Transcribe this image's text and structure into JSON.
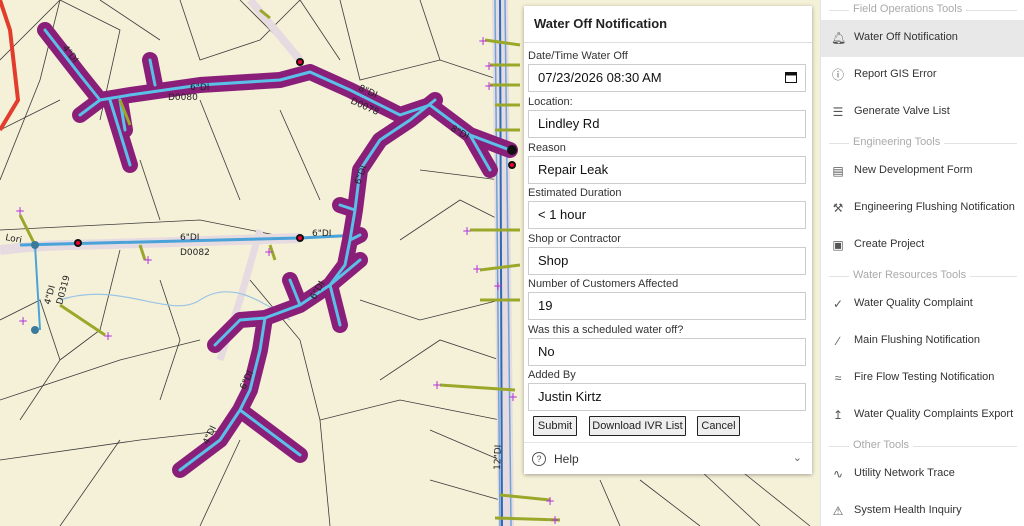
{
  "map": {
    "pipe_labels": [
      {
        "text": "4\"DI",
        "k": "a"
      },
      {
        "text": "6\"DI",
        "k": "b"
      },
      {
        "text": "D0080",
        "k": "c"
      },
      {
        "text": "8\"DI",
        "k": "d"
      },
      {
        "text": "D0078",
        "k": "e"
      },
      {
        "text": "8\"DI",
        "k": "f"
      },
      {
        "text": "6\"DI",
        "k": "g"
      },
      {
        "text": "6\"DI",
        "k": "h"
      },
      {
        "text": "6\"DI",
        "k": "i"
      },
      {
        "text": "D0082",
        "k": "j"
      },
      {
        "text": "4\"DI",
        "k": "k"
      },
      {
        "text": "D0319",
        "k": "l"
      },
      {
        "text": "6\"DI",
        "k": "m"
      },
      {
        "text": "6\"DI",
        "k": "n"
      },
      {
        "text": "4\"DI",
        "k": "o"
      },
      {
        "text": "12\"DI",
        "k": "p"
      },
      {
        "text": "Lori",
        "k": "q"
      }
    ]
  },
  "form": {
    "title": "Water Off Notification",
    "fields": [
      {
        "label": "Date/Time Water Off",
        "value": "07/23/2026 08:30  AM"
      },
      {
        "label": "Location:",
        "value": "Lindley Rd"
      },
      {
        "label": "Reason",
        "value": "Repair Leak"
      },
      {
        "label": "Estimated Duration",
        "value": "< 1 hour"
      },
      {
        "label": "Shop or Contractor",
        "value": "Shop"
      },
      {
        "label": "Number of Customers Affected",
        "value": "19"
      },
      {
        "label": "Was this a scheduled water off?",
        "value": "No"
      },
      {
        "label": "Added By",
        "value": "Justin Kirtz"
      }
    ],
    "buttons": {
      "submit": "Submit",
      "download": "Download IVR List",
      "cancel": "Cancel"
    },
    "help": "Help"
  },
  "sidebar": {
    "sections": [
      {
        "title": "Field Operations Tools",
        "items": [
          {
            "label": "Water Off Notification",
            "icon": "bell-icon",
            "active": true
          },
          {
            "label": "Report GIS Error",
            "icon": "error-circle-icon"
          },
          {
            "label": "Generate Valve List",
            "icon": "list-icon"
          }
        ]
      },
      {
        "title": "Engineering Tools",
        "items": [
          {
            "label": "New Development Form",
            "icon": "form-icon"
          },
          {
            "label": "Engineering Flushing Notification",
            "icon": "wrench-icon"
          },
          {
            "label": "Create Project",
            "icon": "folder-icon"
          }
        ]
      },
      {
        "title": "Water Resources Tools",
        "items": [
          {
            "label": "Water Quality Complaint",
            "icon": "check-circle-icon"
          },
          {
            "label": "Main Flushing Notification",
            "icon": "hose-icon"
          },
          {
            "label": "Fire Flow Testing Notification",
            "icon": "flow-icon"
          },
          {
            "label": "Water Quality Complaints Export",
            "icon": "export-icon"
          }
        ]
      },
      {
        "title": "Other Tools",
        "items": [
          {
            "label": "Utility Network Trace",
            "icon": "trace-icon"
          },
          {
            "label": "System Health Inquiry",
            "icon": "warning-icon"
          }
        ]
      }
    ]
  }
}
